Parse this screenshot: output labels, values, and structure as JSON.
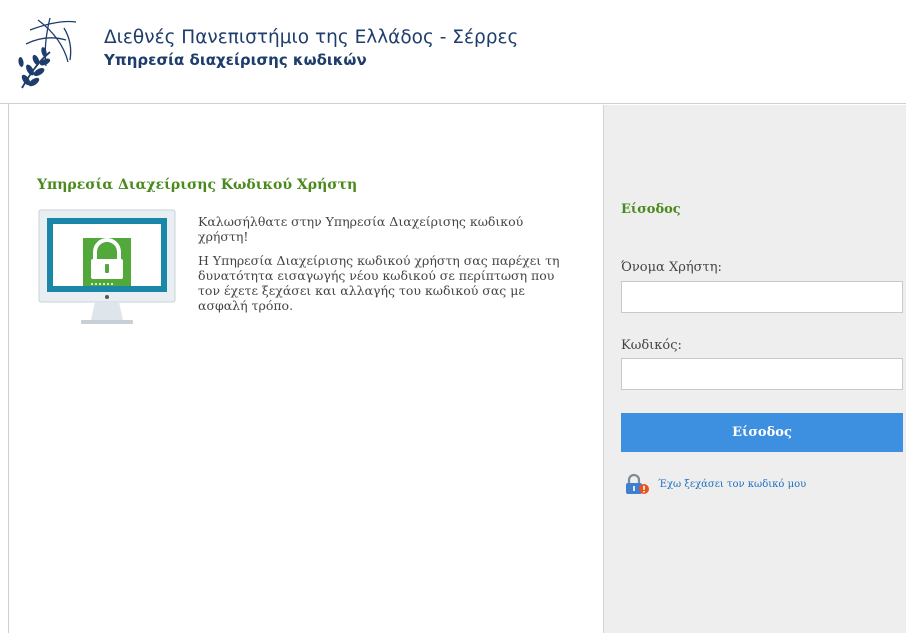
{
  "header": {
    "university_name": "Διεθνές Πανεπιστήμιο της Ελλάδος - Σέρρες",
    "service_name": "Υπηρεσία διαχείρισης κωδικών",
    "logo_icon": "olive-branch-globe-logo-icon"
  },
  "main": {
    "heading": "Υπηρεσία Διαχείρισης Κωδικού Χρήστη",
    "illustration_icon": "monitor-lock-icon",
    "welcome_line": "Καλωσήλθατε στην Υπηρεσία Διαχείρισης κωδικού χρήστη!",
    "description": "Η Υπηρεσία Διαχείρισης κωδικού χρήστη σας παρέχει τη δυνατότητα εισαγωγής νέου κωδικού σε περίπτωση που τον έχετε ξεχάσει και αλλαγής του κωδικού σας με ασφαλή τρόπο."
  },
  "login": {
    "heading": "Είσοδος",
    "username_label": "Όνομα Χρήστη:",
    "username_value": "",
    "password_label": "Κωδικός:",
    "password_value": "",
    "submit_label": "Είσοδος",
    "forgot_icon": "padlock-warning-icon",
    "forgot_link": "Έχω ξεχάσει τον κωδικό μου"
  },
  "colors": {
    "accent_green": "#4a8a1c",
    "header_blue": "#1e3d6b",
    "button_blue": "#3d8fe0",
    "link_blue": "#1f6fbf",
    "panel_gray": "#eeeeee"
  }
}
